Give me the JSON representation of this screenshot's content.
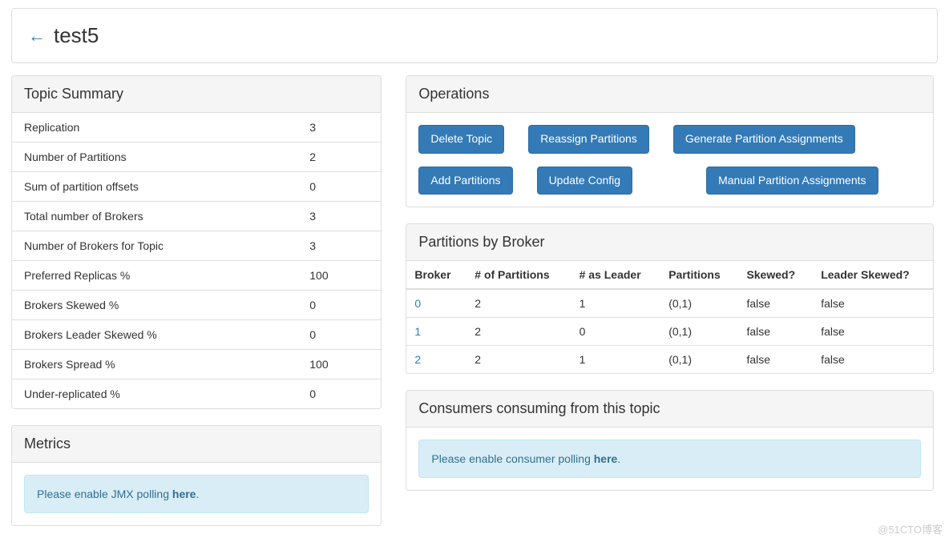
{
  "header": {
    "topic_name": "test5"
  },
  "topic_summary": {
    "title": "Topic Summary",
    "rows": [
      {
        "label": "Replication",
        "value": "3"
      },
      {
        "label": "Number of Partitions",
        "value": "2"
      },
      {
        "label": "Sum of partition offsets",
        "value": "0"
      },
      {
        "label": "Total number of Brokers",
        "value": "3"
      },
      {
        "label": "Number of Brokers for Topic",
        "value": "3"
      },
      {
        "label": "Preferred Replicas %",
        "value": "100"
      },
      {
        "label": "Brokers Skewed %",
        "value": "0"
      },
      {
        "label": "Brokers Leader Skewed %",
        "value": "0"
      },
      {
        "label": "Brokers Spread %",
        "value": "100"
      },
      {
        "label": "Under-replicated %",
        "value": "0"
      }
    ]
  },
  "operations": {
    "title": "Operations",
    "buttons": {
      "delete_topic": "Delete Topic",
      "reassign_partitions": "Reassign Partitions",
      "generate_assignments": "Generate Partition Assignments",
      "add_partitions": "Add Partitions",
      "update_config": "Update Config",
      "manual_assignments": "Manual Partition Assignments"
    }
  },
  "partitions_by_broker": {
    "title": "Partitions by Broker",
    "headers": {
      "broker": "Broker",
      "num_partitions": "# of Partitions",
      "as_leader": "# as Leader",
      "partitions": "Partitions",
      "skewed": "Skewed?",
      "leader_skewed": "Leader Skewed?"
    },
    "rows": [
      {
        "broker": "0",
        "num_partitions": "2",
        "as_leader": "1",
        "partitions": "(0,1)",
        "skewed": "false",
        "leader_skewed": "false"
      },
      {
        "broker": "1",
        "num_partitions": "2",
        "as_leader": "0",
        "partitions": "(0,1)",
        "skewed": "false",
        "leader_skewed": "false"
      },
      {
        "broker": "2",
        "num_partitions": "2",
        "as_leader": "1",
        "partitions": "(0,1)",
        "skewed": "false",
        "leader_skewed": "false"
      }
    ]
  },
  "metrics": {
    "title": "Metrics",
    "alert_prefix": "Please enable JMX polling ",
    "alert_link": "here",
    "alert_suffix": "."
  },
  "consumers": {
    "title": "Consumers consuming from this topic",
    "alert_prefix": "Please enable consumer polling ",
    "alert_link": "here",
    "alert_suffix": "."
  },
  "watermark": "@51CTO博客"
}
